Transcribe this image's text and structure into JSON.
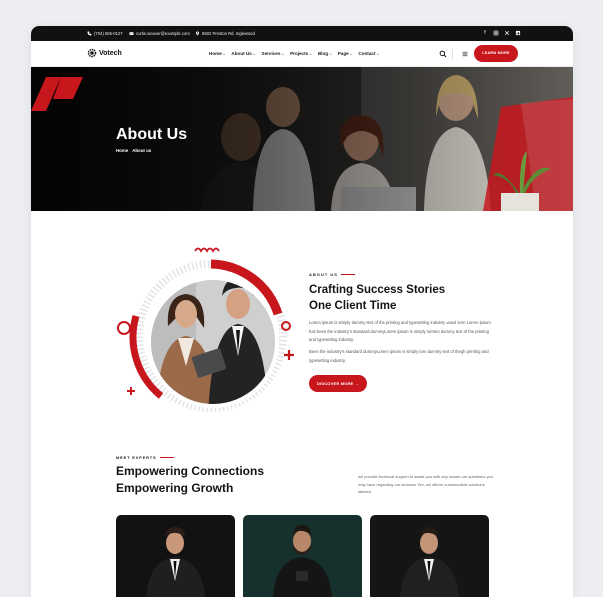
{
  "topbar": {
    "phone": "(704) 555-0127",
    "email": "curtis.weaver@example.com",
    "address": "6502 Preston Rd. Inglewood",
    "socials": [
      "facebook-icon",
      "instagram-icon",
      "x-icon",
      "linkedin-icon"
    ]
  },
  "nav": {
    "logo": "Votech",
    "menu": [
      {
        "label": "Home",
        "dropdown": true
      },
      {
        "label": "About Us",
        "dropdown": true
      },
      {
        "label": "Services",
        "dropdown": true
      },
      {
        "label": "Projects",
        "dropdown": true
      },
      {
        "label": "Blog",
        "dropdown": true
      },
      {
        "label": "Page",
        "dropdown": true
      },
      {
        "label": "Contact",
        "dropdown": true
      }
    ],
    "cta": "LEARN MORE"
  },
  "hero": {
    "title": "About Us",
    "breadcrumb": [
      "Home",
      "About us"
    ]
  },
  "about": {
    "label": "ABOUT US",
    "title_line1": "Crafting Success Stories",
    "title_line2": "One Client Time",
    "p1": "Lorem ipsum is simply dummy text of the printing and typesetting industry vaoel ienn Lorem ipsum has been the industry's standard dummyLorem ipsum is simply iormeo dummy text of the printing and typesetting industry.",
    "p2": "Been the industry's standard dummyLorem ipsum is simply iorn dummy text of thegh printing and typesetting industry.",
    "cta": "DISCOVER MORE →"
  },
  "experts": {
    "label": "MEET EXPERTS",
    "title_line1": "Empowering Connections",
    "title_line2": "Empowering Growth",
    "text": "we provide technical support to assist you with any issues oar questions you may have regarding our services Yes, we offerm customizable solutions tailored"
  },
  "colors": {
    "brand_red": "#c8161d",
    "dark": "#111111"
  }
}
